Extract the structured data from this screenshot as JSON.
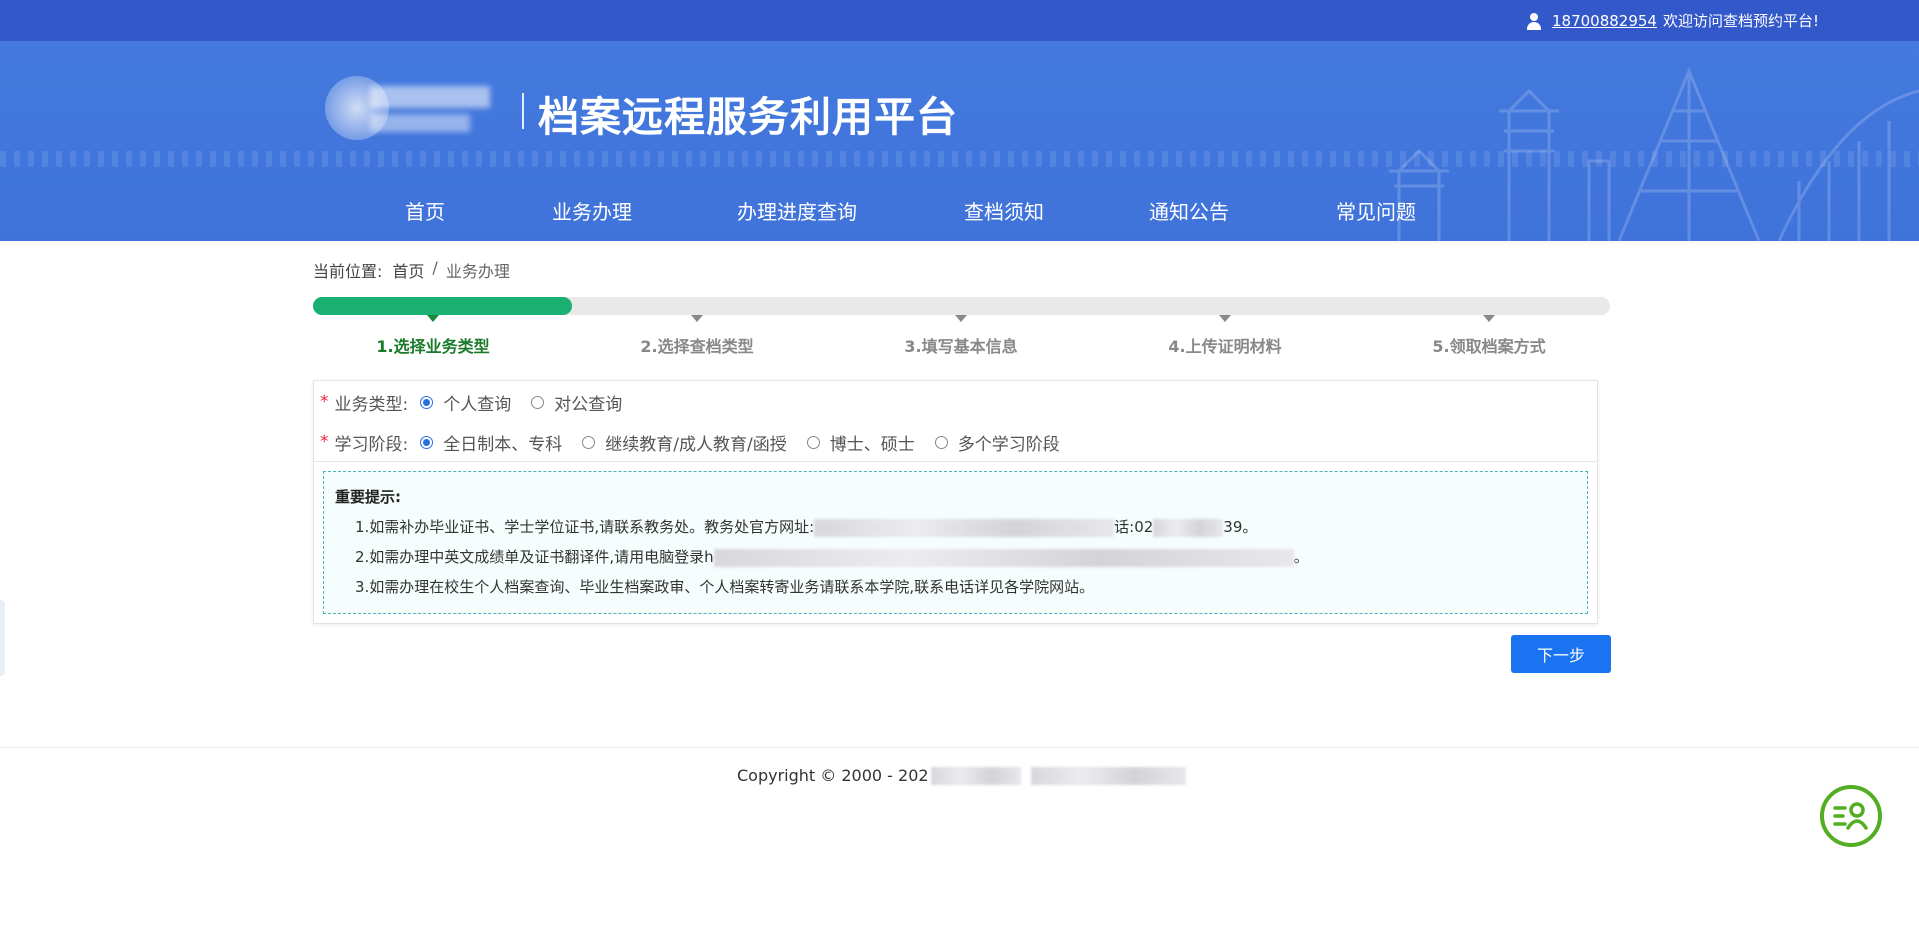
{
  "topbar": {
    "phone": "18700882954",
    "welcome": "欢迎访问查档预约平台!"
  },
  "header": {
    "site_title": "档案远程服务利用平台"
  },
  "nav": [
    {
      "label": "首页"
    },
    {
      "label": "业务办理"
    },
    {
      "label": "办理进度查询"
    },
    {
      "label": "查档须知"
    },
    {
      "label": "通知公告"
    },
    {
      "label": "常见问题"
    }
  ],
  "breadcrumb": {
    "prefix": "当前位置:",
    "home": "首页",
    "separator": "/",
    "current": "业务办理"
  },
  "steps": {
    "current": 1,
    "total": 5,
    "progress_fraction": 0.2,
    "items": [
      {
        "label": "1.选择业务类型"
      },
      {
        "label": "2.选择查档类型"
      },
      {
        "label": "3.填写基本信息"
      },
      {
        "label": "4.上传证明材料"
      },
      {
        "label": "5.领取档案方式"
      }
    ]
  },
  "form": {
    "required_mark": "*",
    "business_type": {
      "label": "业务类型:",
      "options": [
        "个人查询",
        "对公查询"
      ],
      "selected": "个人查询"
    },
    "study_stage": {
      "label": "学习阶段:",
      "options": [
        "全日制本、专科",
        "继续教育/成人教育/函授",
        "博士、硕士",
        "多个学习阶段"
      ],
      "selected": "全日制本、专科"
    }
  },
  "notice": {
    "title": "重要提示:",
    "line1_a": "1.如需补办毕业证书、学士学位证书,请联系教务处。教务处官方网址:",
    "line1_b": "话:02",
    "line1_c": "39。",
    "line2_a": "2.如需办理中英文成绩单及证书翻译件,请用电脑登录h",
    "line2_b": "。",
    "line3": "3.如需办理在校生个人档案查询、毕业生档案政审、个人档案转寄业务请联系本学院,联系电话详见各学院网站。"
  },
  "actions": {
    "next_label": "下一步"
  },
  "footer": {
    "copyright": "Copyright © 2000 - 202"
  },
  "colors": {
    "topbar": "#3358c9",
    "banner": "#4479de",
    "progress_active": "#1ab071",
    "primary_button": "#1a73f0",
    "required": "#e22233",
    "chat_widget": "#53ae24"
  }
}
